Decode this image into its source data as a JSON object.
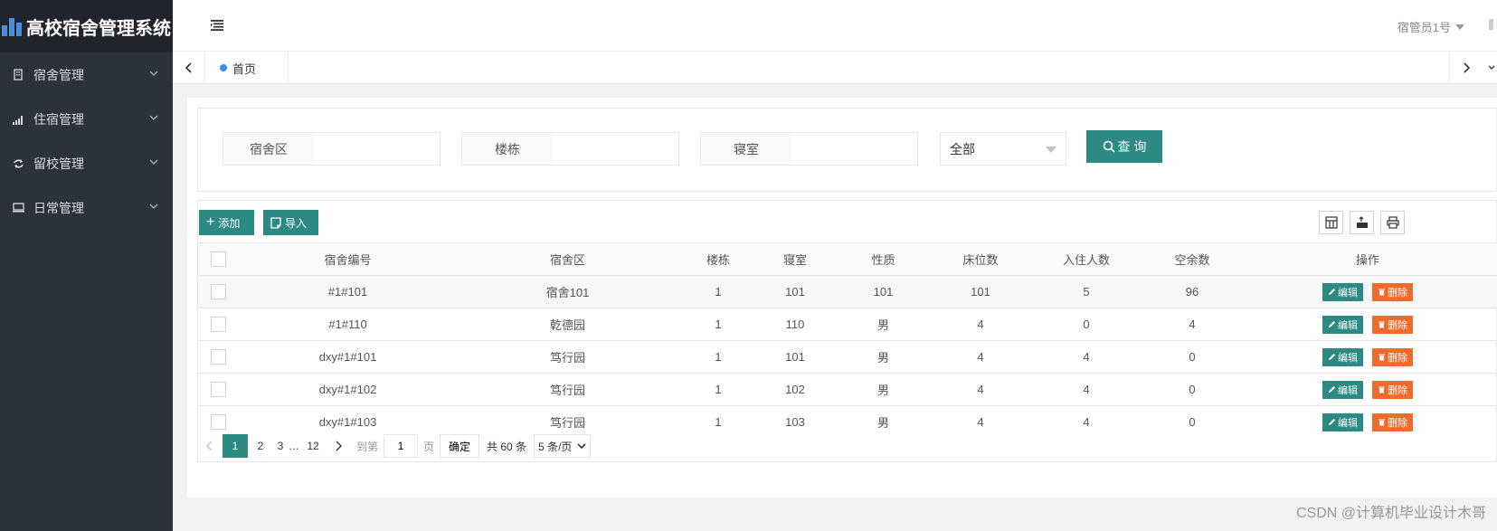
{
  "brand": {
    "title": "高校宿舍管理系统",
    "color": "#4a8fd8"
  },
  "sidebar": {
    "items": [
      {
        "label": "宿舍管理",
        "icon": "building-icon"
      },
      {
        "label": "住宿管理",
        "icon": "signal-bars-icon"
      },
      {
        "label": "留校管理",
        "icon": "refresh-icon"
      },
      {
        "label": "日常管理",
        "icon": "monitor-icon"
      }
    ]
  },
  "header": {
    "user": "宿管员1号"
  },
  "tabs": {
    "home": "首页"
  },
  "search": {
    "area_label": "宿舍区",
    "building_label": "楼栋",
    "room_label": "寝室",
    "area_value": "",
    "building_value": "",
    "room_value": "",
    "select_value": "全部",
    "query_label": "查 询"
  },
  "toolbar": {
    "add_label": "添加",
    "import_label": "导入"
  },
  "table": {
    "headers": [
      "宿舍编号",
      "宿舍区",
      "楼栋",
      "寝室",
      "性质",
      "床位数",
      "入住人数",
      "空余数",
      "操作"
    ],
    "rows": [
      [
        "#1#101",
        "宿舍101",
        "1",
        "101",
        "101",
        "101",
        "5",
        "96"
      ],
      [
        "#1#110",
        "乾德园",
        "1",
        "110",
        "男",
        "4",
        "0",
        "4"
      ],
      [
        "dxy#1#101",
        "笃行园",
        "1",
        "101",
        "男",
        "4",
        "4",
        "0"
      ],
      [
        "dxy#1#102",
        "笃行园",
        "1",
        "102",
        "男",
        "4",
        "4",
        "0"
      ],
      [
        "dxy#1#103",
        "笃行园",
        "1",
        "103",
        "男",
        "4",
        "4",
        "0"
      ]
    ],
    "edit_label": "编辑",
    "delete_label": "删除"
  },
  "pager": {
    "pages": [
      "1",
      "2",
      "3",
      "…",
      "12"
    ],
    "goto_label": "到第",
    "goto_value": "1",
    "page_unit": "页",
    "confirm_label": "确定",
    "total_text": "共 60 条",
    "size_value": "5 条/页"
  },
  "watermark": "CSDN @计算机毕业设计木哥",
  "colors": {
    "primary": "#2d8a82",
    "danger": "#f06a2c",
    "sidebar": "#2b323c",
    "tab_dot": "#3a8ee6"
  }
}
